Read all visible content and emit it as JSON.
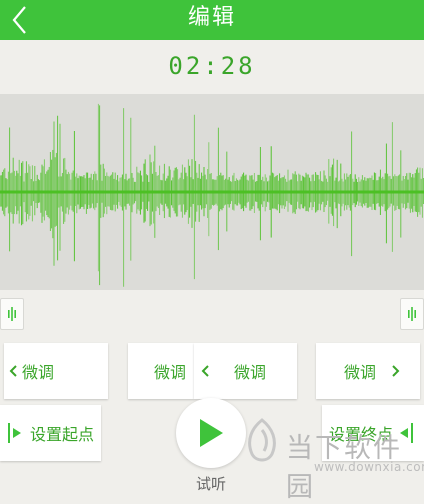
{
  "header": {
    "title": "编辑"
  },
  "player": {
    "time": "02:28",
    "play_label": "试听"
  },
  "adjust": {
    "start_minus": "微调",
    "start_plus": "微调",
    "end_minus": "微调",
    "end_plus": "微调"
  },
  "markers": {
    "set_start": "设置起点",
    "set_end": "设置终点"
  },
  "watermark": {
    "text": "当下软件园",
    "url": "www.downxia.com"
  },
  "colors": {
    "accent": "#3fc33b",
    "text_green": "#3aa52a",
    "wave": "#4cc024",
    "wave_bg": "#dcdcd8"
  }
}
